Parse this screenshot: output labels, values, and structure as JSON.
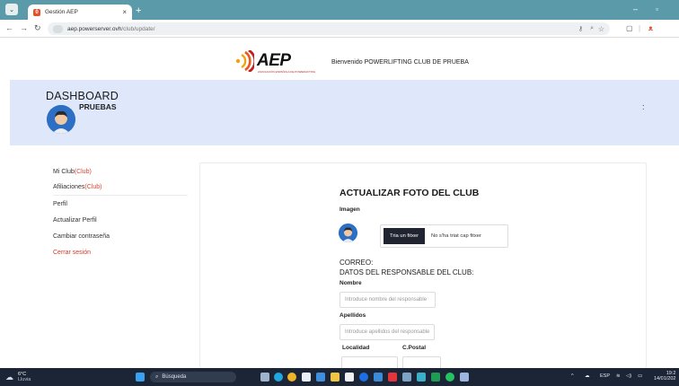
{
  "browser": {
    "tab_title": "Gestión AEP",
    "tab_close": "×",
    "new_tab": "+",
    "url_domain": "aep.powerserver.ovh",
    "url_path": "/club/update/",
    "minimize": "–",
    "restore": "▫"
  },
  "site": {
    "logo_text": "AEP",
    "logo_tagline": "ASOCIACIÓN ESPAÑOLA DE POWERLIFTING",
    "welcome": "Bienvenido POWERLIFTING CLUB DE PRUEBA"
  },
  "dashboard": {
    "title": "DASHBOARD",
    "user": "PRUEBAS",
    "menu": ":"
  },
  "sidebar": {
    "items": [
      {
        "label": "Mi Club",
        "suffix": "(Club)"
      },
      {
        "label": "Afiliaciones",
        "suffix": "(Club)"
      },
      {
        "label": "Perfil",
        "suffix": ""
      },
      {
        "label": "Actualizar Perfil",
        "suffix": ""
      },
      {
        "label": "Cambiar contraseña",
        "suffix": ""
      },
      {
        "label": "Cerrar sesión",
        "suffix": ""
      }
    ]
  },
  "form": {
    "title": "ACTUALIZAR FOTO DEL CLUB",
    "image_label": "Imagen",
    "file_button": "Tria un fitxer",
    "file_status": "No s'ha triat cap fitxer",
    "correo_label": "CORREO:",
    "responsable_heading": "DATOS DEL RESPONSABLE DEL CLUB:",
    "nombre_label": "Nombre",
    "nombre_placeholder": "Introduce nombre del responsable",
    "apellidos_label": "Apellidos",
    "apellidos_placeholder": "Introduce apellidos del responsable",
    "localidad_label": "Localidad",
    "cpostal_label": "C.Postal"
  },
  "taskbar": {
    "temperature": "6°C",
    "weather": "Lluvia",
    "search": "Búsqueda",
    "lang": "ESP",
    "time": "19:2",
    "date": "14/01/202"
  },
  "colors": {
    "accent_red": "#e0452f",
    "dash_bg": "#dfe8fb",
    "titlebar": "#5b9aa8",
    "avatar_blue": "#2c6fc4"
  }
}
